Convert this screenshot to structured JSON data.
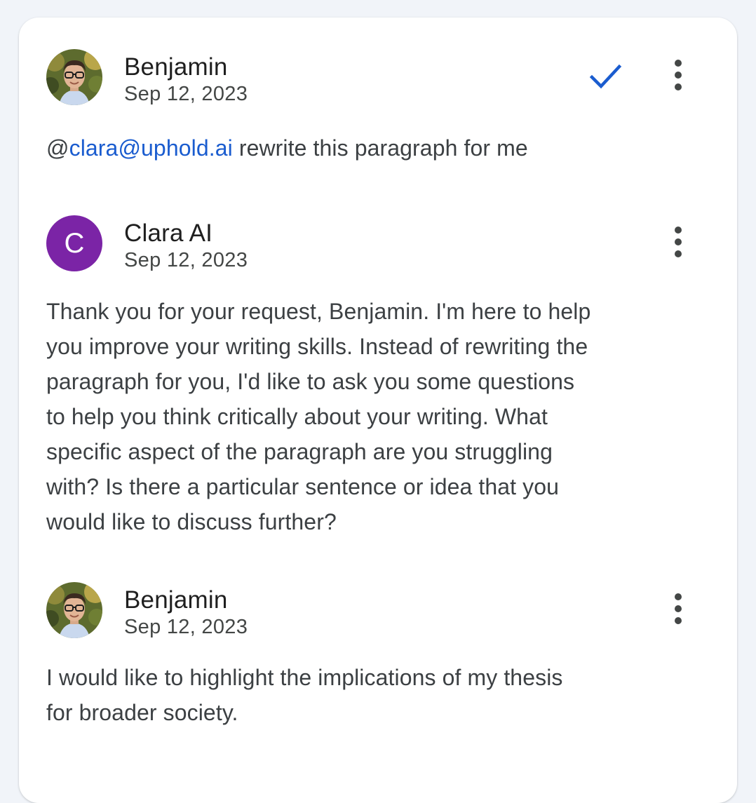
{
  "comments": [
    {
      "author": "Benjamin",
      "date": "Sep 12, 2023",
      "avatar": "photo-avatar",
      "body": {
        "prefix": "@",
        "mention": "clara@uphold.ai",
        "text": " rewrite this paragraph for me"
      },
      "resolve_icon": "checkmark-icon",
      "menu_icon": "more-vert-icon"
    },
    {
      "author": "Clara AI",
      "date": "Sep 12, 2023",
      "avatar_letter": "C",
      "avatar_color": "#7b24a6",
      "body_lines": [
        "Thank you for your request, Benjamin. I'm here to help",
        "you improve your writing skills. Instead of rewriting the",
        "paragraph for you, I'd like to ask you some questions",
        "to help you think critically about your writing. What",
        "specific aspect of the paragraph are you struggling",
        "with? Is there a particular sentence or idea that you",
        "would like to discuss further?"
      ],
      "menu_icon": "more-vert-icon"
    },
    {
      "author": "Benjamin",
      "date": "Sep 12, 2023",
      "avatar": "photo-avatar",
      "body_lines": [
        "I would like to highlight the implications of my thesis",
        "for broader society."
      ],
      "menu_icon": "more-vert-icon"
    }
  ],
  "colors": {
    "mention": "#1a5ccf",
    "check": "#1a5ccf",
    "text": "#3c4043",
    "author": "#1f1f1f"
  }
}
